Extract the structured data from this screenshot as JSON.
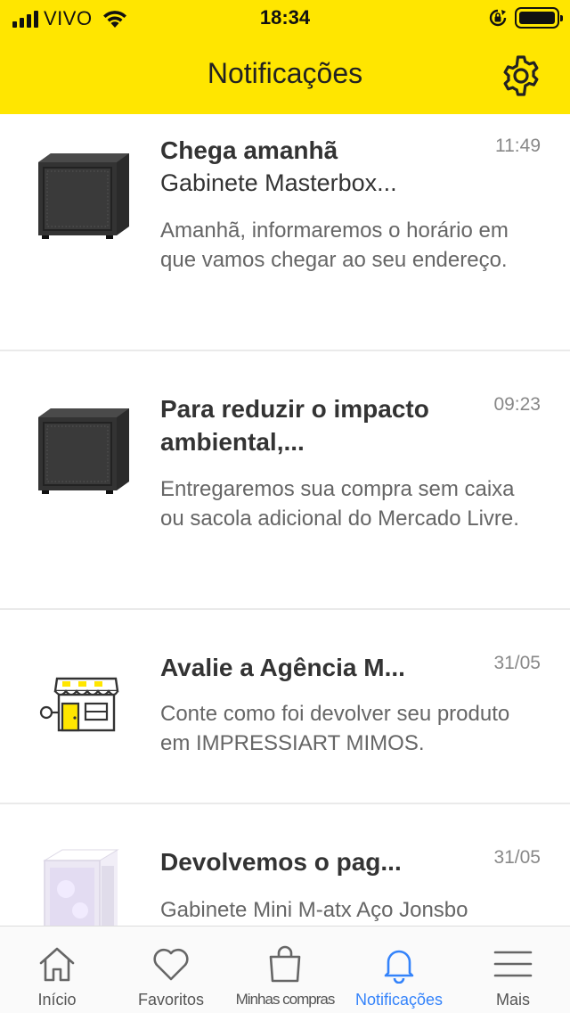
{
  "status_bar": {
    "carrier": "VIVO",
    "time": "18:34"
  },
  "header": {
    "title": "Notificações",
    "settings_icon": "gear-icon"
  },
  "notifications": [
    {
      "title": "Chega amanhã",
      "subtitle": "Gabinete Masterbox...",
      "body": "Amanhã, informaremos o horário em que vamos chegar ao seu endereço.",
      "time": "11:49",
      "thumbnail": "pc-case-black"
    },
    {
      "title": "Para reduzir o impacto ambiental,...",
      "subtitle": "",
      "body": "Entregaremos sua compra sem caixa ou sacola adicional do Mercado Livre.",
      "time": "09:23",
      "thumbnail": "pc-case-black"
    },
    {
      "title": "Avalie a Agência M...",
      "subtitle": "",
      "body": "Conte como foi devolver seu produto em IMPRESSIART MIMOS.",
      "time": "31/05",
      "thumbnail": "store-icon"
    },
    {
      "title": "Devolvemos o pag...",
      "subtitle": "",
      "body": "Gabinete Mini M-atx Aço Jonsbo",
      "time": "31/05",
      "thumbnail": "pc-case-white"
    }
  ],
  "tab_bar": {
    "tabs": [
      {
        "label": "Início",
        "icon": "home-icon",
        "active": false
      },
      {
        "label": "Favoritos",
        "icon": "heart-icon",
        "active": false
      },
      {
        "label": "Minhas compras",
        "icon": "shopping-bag-icon",
        "active": false
      },
      {
        "label": "Notificações",
        "icon": "bell-icon",
        "active": true
      },
      {
        "label": "Mais",
        "icon": "menu-icon",
        "active": false
      }
    ],
    "active_color": "#3483fa"
  },
  "colors": {
    "header_yellow": "#ffe600",
    "accent_blue": "#3483fa"
  }
}
